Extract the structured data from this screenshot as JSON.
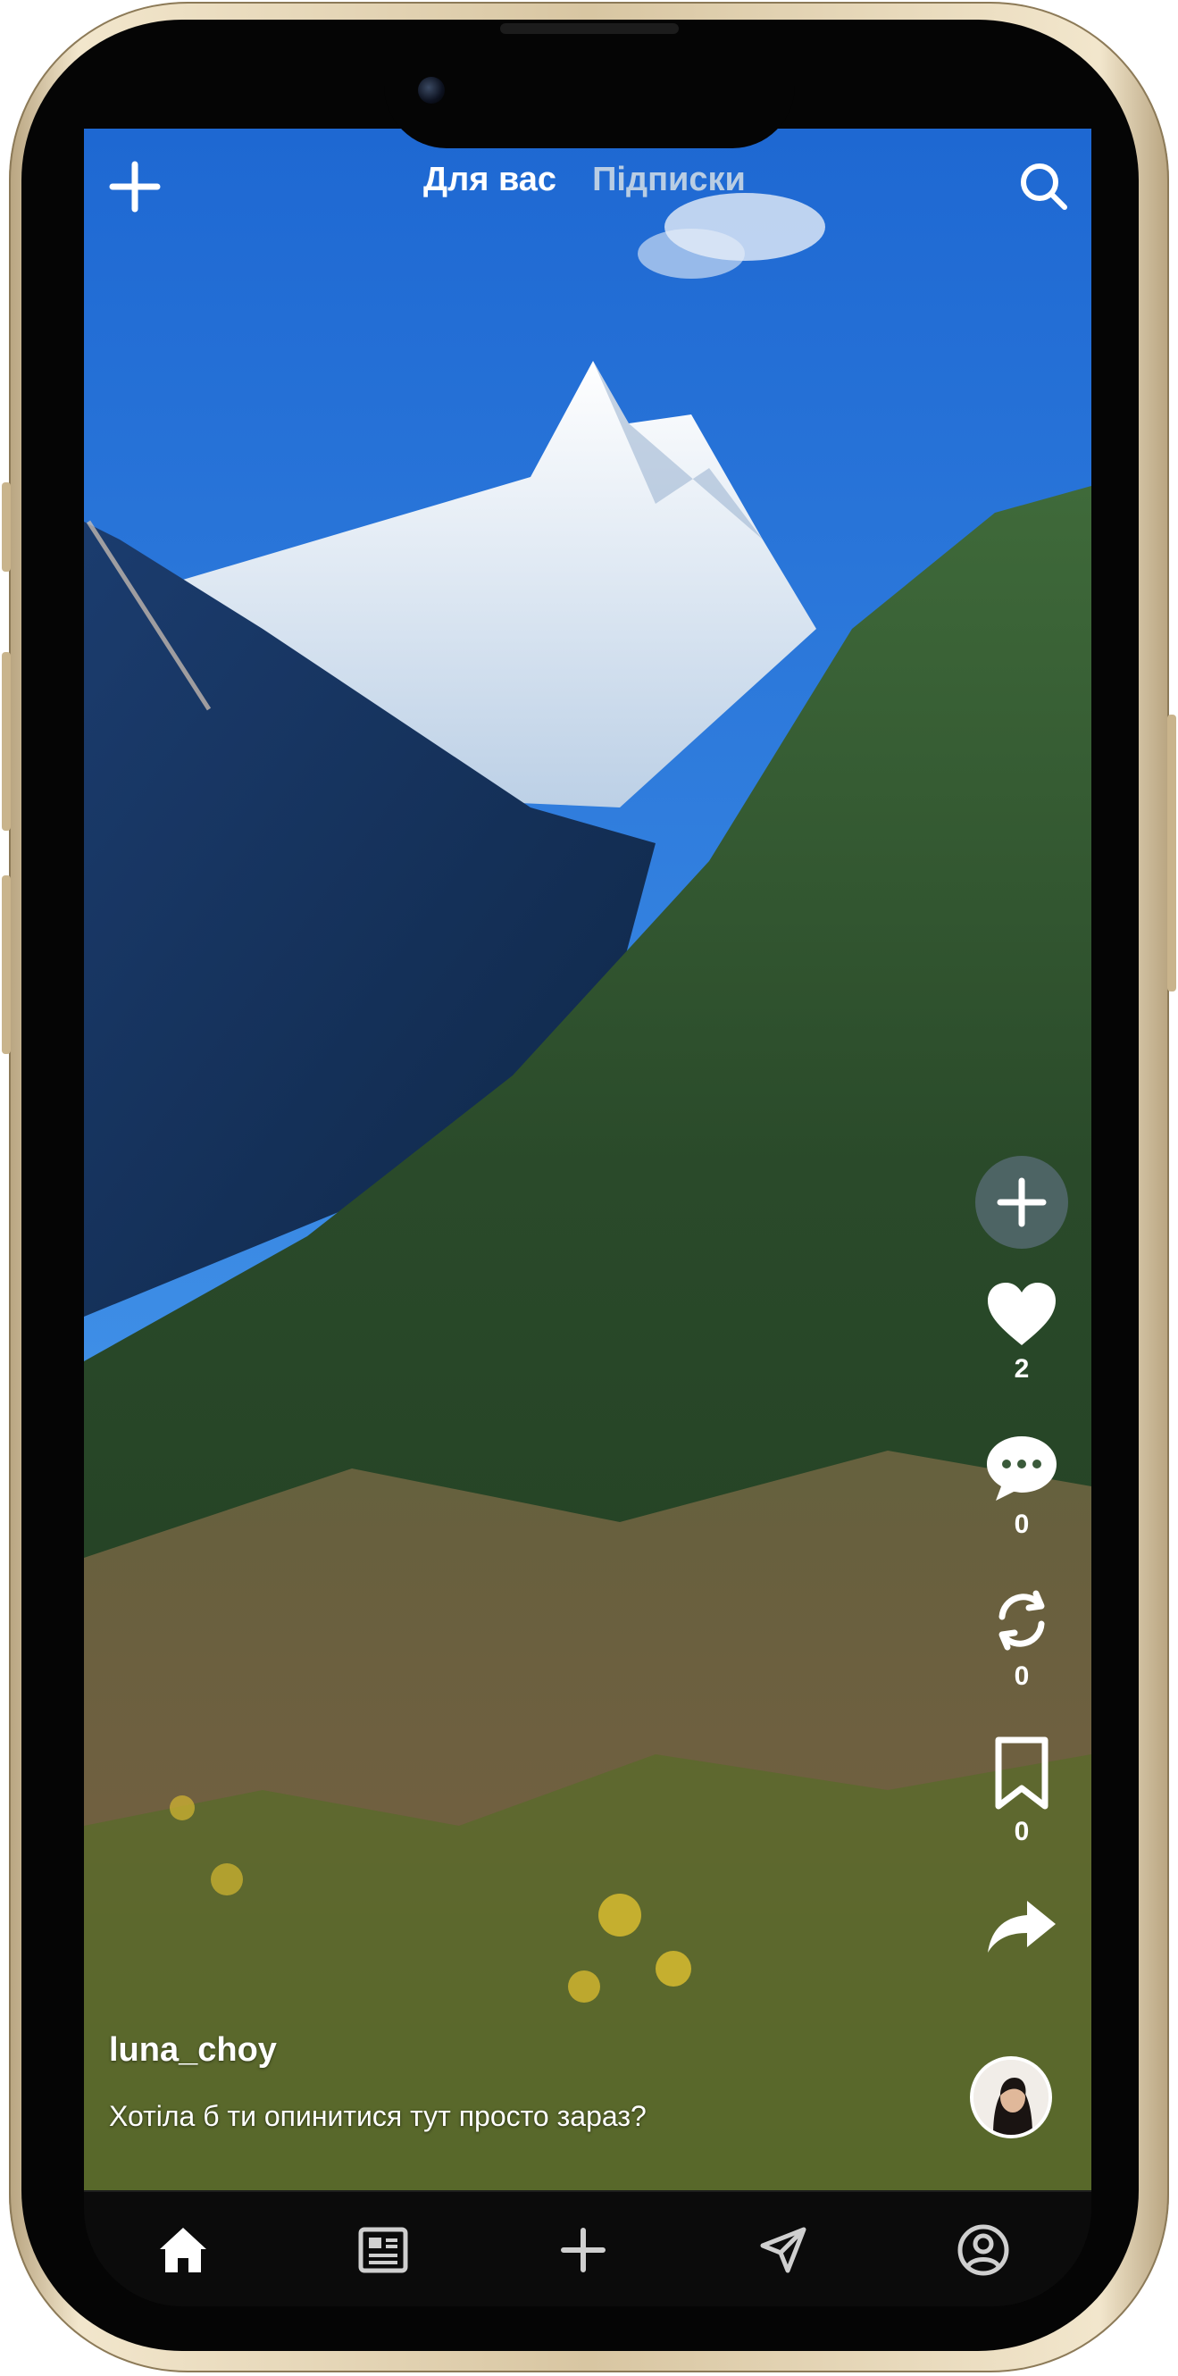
{
  "top_bar": {
    "tabs": [
      {
        "label": "Для вас",
        "active": true
      },
      {
        "label": "Підписки",
        "active": false
      }
    ],
    "add_icon": "plus-icon",
    "search_icon": "search-icon"
  },
  "actions": {
    "follow_icon": "plus-icon",
    "likes": {
      "icon": "heart-icon",
      "count": "2"
    },
    "comments": {
      "icon": "comment-icon",
      "count": "0"
    },
    "reposts": {
      "icon": "repost-icon",
      "count": "0"
    },
    "bookmarks": {
      "icon": "bookmark-icon",
      "count": "0"
    },
    "share_icon": "share-icon"
  },
  "post": {
    "username": "luna_choy",
    "caption": "Хотіла б ти опинитися тут просто зараз?"
  },
  "bottom_nav": [
    {
      "name": "home",
      "icon": "home-icon",
      "active": true
    },
    {
      "name": "feed",
      "icon": "newspaper-icon",
      "active": false
    },
    {
      "name": "create",
      "icon": "plus-icon",
      "active": false
    },
    {
      "name": "messages",
      "icon": "send-icon",
      "active": false
    },
    {
      "name": "profile",
      "icon": "profile-icon",
      "active": false
    }
  ],
  "colors": {
    "accent_text": "#ffffff",
    "inactive_tab": "#b9cde3",
    "nav_bg": "#0b0b0b",
    "frame_gold": "#d8c6a2"
  }
}
